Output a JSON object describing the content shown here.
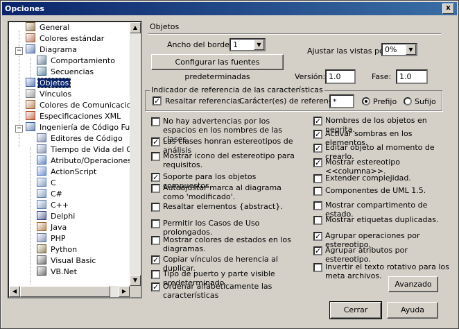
{
  "window": {
    "title": "Opciones",
    "close_glyph": "x"
  },
  "tree": {
    "items": [
      {
        "label": "General",
        "icon": "general-icon",
        "color": "#7a5a30"
      },
      {
        "label": "Colores estándar",
        "icon": "palette-icon",
        "color": "#a05030"
      },
      {
        "label": "Diagrama",
        "icon": "diagram-icon",
        "color": "#4060a0"
      },
      {
        "label": "Comportamiento",
        "icon": "behavior-icon",
        "color": "#406080"
      },
      {
        "label": "Secuencias",
        "icon": "sequence-icon",
        "color": "#306080"
      },
      {
        "label": "Objetos",
        "icon": "objects-icon",
        "color": "#3050a0"
      },
      {
        "label": "Vínculos",
        "icon": "link-icon",
        "color": "#808080"
      },
      {
        "label": "Colores de Comunicaciones",
        "icon": "brush-icon",
        "color": "#a06030"
      },
      {
        "label": "Especificaciones XML",
        "icon": "xml-icon",
        "color": "#b04020"
      },
      {
        "label": "Ingeniería de Código Fuente",
        "icon": "source-code-icon",
        "color": "#4060a0"
      },
      {
        "label": "Editores de Código",
        "icon": "code-editor-icon",
        "color": "#6070a0"
      },
      {
        "label": "Tiempo de Vida del Objeto",
        "icon": "lifetime-icon",
        "color": "#6070a0"
      },
      {
        "label": "Atributo/Operaciones",
        "icon": "attribute-icon",
        "color": "#3060b0"
      },
      {
        "label": "ActionScript",
        "icon": "actionscript-icon",
        "color": "#4070c0"
      },
      {
        "label": "C",
        "icon": "c-icon",
        "color": "#6080b0"
      },
      {
        "label": "C#",
        "icon": "csharp-icon",
        "color": "#6080b0"
      },
      {
        "label": "C++",
        "icon": "cpp-icon",
        "color": "#6080b0"
      },
      {
        "label": "Delphi",
        "icon": "delphi-icon",
        "color": "#304080"
      },
      {
        "label": "Java",
        "icon": "java-icon",
        "color": "#a06020"
      },
      {
        "label": "PHP",
        "icon": "php-icon",
        "color": "#6070a0"
      },
      {
        "label": "Python",
        "icon": "python-icon",
        "color": "#706030"
      },
      {
        "label": "Visual Basic",
        "icon": "vb-icon",
        "color": "#404040"
      },
      {
        "label": "VB.Net",
        "icon": "vbnet-icon",
        "color": "#404040"
      }
    ]
  },
  "section": {
    "title": "Objetos"
  },
  "border": {
    "label": "Ancho del borde:",
    "value": "1"
  },
  "fit": {
    "label": "Ajustar las vistas por:",
    "value": "0%"
  },
  "config_button": "Configurar las fuentes predeterminadas",
  "version": {
    "label": "Versión:",
    "value": "1.0"
  },
  "phase": {
    "label": "Fase:",
    "value": "1.0"
  },
  "refgroup": {
    "title": "Indicador de referencia de las características",
    "highlight": "Resaltar referencias.",
    "chars_label": "Carácter(es) de referencia.",
    "chars_value": "*",
    "prefix": "Prefijo",
    "suffix": "Sufijo"
  },
  "left_options": [
    {
      "label": "No hay advertencias por los espacios en los nombres de las clases.",
      "checked": false
    },
    {
      "label": "Las clases honran estereotipos de análisis",
      "checked": true
    },
    {
      "label": "Mostrar icono del estereotipo para requisitos.",
      "checked": false
    },
    {
      "label": "Soporte para los objetos compuestos.",
      "checked": true
    },
    {
      "label": "Autoajustar marca al diagrama como 'modificado'.",
      "checked": false
    },
    {
      "label": "Resaltar elementos {abstract}.",
      "checked": false
    },
    {
      "label": "Permitir los Casos de Uso prolongados.",
      "checked": false
    },
    {
      "label": "Mostrar colores de estados en los diagramas.",
      "checked": false
    },
    {
      "label": "Copiar vínculos de herencia al duplicar.",
      "checked": true
    },
    {
      "label": "Tipo de puerto y parte visible predeterminado.",
      "checked": false
    },
    {
      "label": "Ordenar alfabéticamente las características",
      "checked": true
    }
  ],
  "right_options": [
    {
      "label": "Nombres de los objetos en negrita.",
      "checked": true
    },
    {
      "label": "Activar sombras en los elementos.",
      "checked": true
    },
    {
      "label": "Editar objeto al momento de crearlo.",
      "checked": true
    },
    {
      "label": "Mostrar estereotipo <<columna>>.",
      "checked": true
    },
    {
      "label": "Extender complejidad.",
      "checked": false
    },
    {
      "label": "Componentes de UML 1.5.",
      "checked": false
    },
    {
      "label": "Mostrar compartimento de estado.",
      "checked": false
    },
    {
      "label": "Mostrar etiquetas duplicadas.",
      "checked": false
    },
    {
      "label": "Agrupar operaciones por estereotipo.",
      "checked": true
    },
    {
      "label": "Agrupar atributos por estereotipo.",
      "checked": true
    },
    {
      "label": "Invertir el texto rotativo para los meta archivos.",
      "checked": false
    }
  ],
  "buttons": {
    "advanced": "Avanzado",
    "close": "Cerrar",
    "help": "Ayuda"
  }
}
